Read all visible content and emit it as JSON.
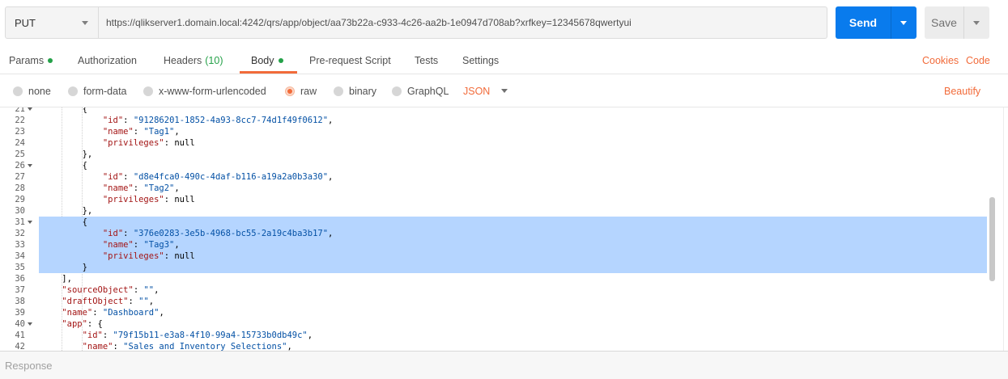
{
  "request": {
    "method": "PUT",
    "url": "https://qlikserver1.domain.local:4242/qrs/app/object/aa73b22a-c933-4c26-aa2b-1e0947d708ab?xrfkey=12345678qwertyui",
    "send_label": "Send",
    "save_label": "Save"
  },
  "tabs": {
    "params": "Params",
    "authorization": "Authorization",
    "headers": "Headers",
    "headers_count": "(10)",
    "body": "Body",
    "prerequest": "Pre-request Script",
    "tests": "Tests",
    "settings": "Settings",
    "cookies": "Cookies",
    "code": "Code",
    "active": "Body"
  },
  "body_types": {
    "none": "none",
    "form_data": "form-data",
    "urlencoded": "x-www-form-urlencoded",
    "raw": "raw",
    "binary": "binary",
    "graphql": "GraphQL",
    "selected": "raw",
    "language": "JSON",
    "beautify": "Beautify"
  },
  "colors": {
    "accent": "#f26b3a",
    "send_button": "#097bed",
    "status_dot": "#24a148",
    "selection": "#b5d5ff"
  },
  "editor": {
    "lines": [
      {
        "n": "21",
        "fold": true,
        "hl": false,
        "text": "        {"
      },
      {
        "n": "22",
        "fold": false,
        "hl": false,
        "text": "            \"id\": \"91286201-1852-4a93-8cc7-74d1f49f0612\","
      },
      {
        "n": "23",
        "fold": false,
        "hl": false,
        "text": "            \"name\": \"Tag1\","
      },
      {
        "n": "24",
        "fold": false,
        "hl": false,
        "text": "            \"privileges\": null"
      },
      {
        "n": "25",
        "fold": false,
        "hl": false,
        "text": "        },"
      },
      {
        "n": "26",
        "fold": true,
        "hl": false,
        "text": "        {"
      },
      {
        "n": "27",
        "fold": false,
        "hl": false,
        "text": "            \"id\": \"d8e4fca0-490c-4daf-b116-a19a2a0b3a30\","
      },
      {
        "n": "28",
        "fold": false,
        "hl": false,
        "text": "            \"name\": \"Tag2\","
      },
      {
        "n": "29",
        "fold": false,
        "hl": false,
        "text": "            \"privileges\": null"
      },
      {
        "n": "30",
        "fold": false,
        "hl": false,
        "text": "        },"
      },
      {
        "n": "31",
        "fold": true,
        "hl": true,
        "text": "        {"
      },
      {
        "n": "32",
        "fold": false,
        "hl": true,
        "text": "            \"id\": \"376e0283-3e5b-4968-bc55-2a19c4ba3b17\","
      },
      {
        "n": "33",
        "fold": false,
        "hl": true,
        "text": "            \"name\": \"Tag3\","
      },
      {
        "n": "34",
        "fold": false,
        "hl": true,
        "text": "            \"privileges\": null"
      },
      {
        "n": "35",
        "fold": false,
        "hl": true,
        "text": "        }"
      },
      {
        "n": "36",
        "fold": false,
        "hl": false,
        "text": "    ],"
      },
      {
        "n": "37",
        "fold": false,
        "hl": false,
        "text": "    \"sourceObject\": \"\","
      },
      {
        "n": "38",
        "fold": false,
        "hl": false,
        "text": "    \"draftObject\": \"\","
      },
      {
        "n": "39",
        "fold": false,
        "hl": false,
        "text": "    \"name\": \"Dashboard\","
      },
      {
        "n": "40",
        "fold": true,
        "hl": false,
        "text": "    \"app\": {"
      },
      {
        "n": "41",
        "fold": false,
        "hl": false,
        "text": "        \"id\": \"79f15b11-e3a8-4f10-99a4-15733b0db49c\","
      },
      {
        "n": "42",
        "fold": false,
        "hl": false,
        "text": "        \"name\": \"Sales and Inventory Selections\","
      }
    ]
  },
  "response": {
    "label": "Response"
  }
}
